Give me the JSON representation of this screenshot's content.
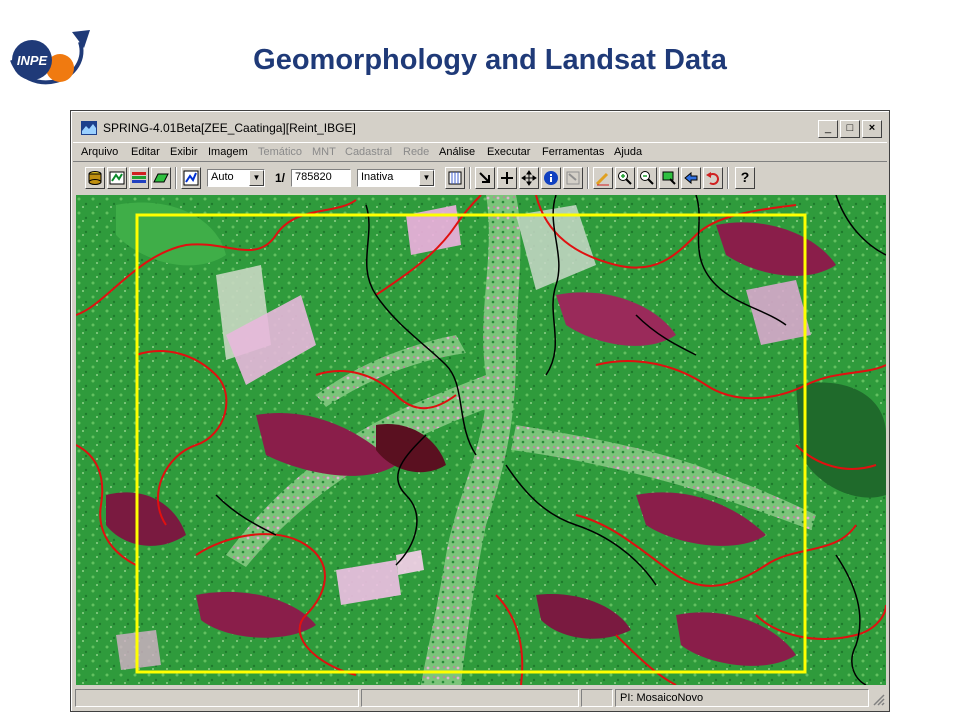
{
  "slide": {
    "title": "Geomorphology and Landsat Data",
    "logo_text": "INPE"
  },
  "window": {
    "title": "SPRING-4.01Beta[ZEE_Caatinga][Reint_IBGE]",
    "controls": {
      "minimize": "_",
      "maximize": "□",
      "close": "×"
    }
  },
  "menu": {
    "items": [
      {
        "label": "Arquivo",
        "enabled": true
      },
      {
        "label": "Editar",
        "enabled": true
      },
      {
        "label": "Exibir",
        "enabled": true
      },
      {
        "label": "Imagem",
        "enabled": true
      },
      {
        "label": "Temático",
        "enabled": false
      },
      {
        "label": "MNT",
        "enabled": false
      },
      {
        "label": "Cadastral",
        "enabled": false
      },
      {
        "label": "Rede",
        "enabled": false
      },
      {
        "label": "Análise",
        "enabled": true
      },
      {
        "label": "Executar",
        "enabled": true
      },
      {
        "label": "Ferramentas",
        "enabled": true
      },
      {
        "label": "Ajuda",
        "enabled": true
      }
    ]
  },
  "toolbar": {
    "zoom_mode": "Auto",
    "scale_prefix": "1/",
    "scale_value": "785820",
    "cursor_mode": "Inativa",
    "help_glyph": "?"
  },
  "status": {
    "plan": "PI: MosaicoNovo"
  },
  "colors": {
    "title": "#1f3a78",
    "selection_box": "#ffff00",
    "vector_red": "#e01010",
    "vector_black": "#000000"
  }
}
